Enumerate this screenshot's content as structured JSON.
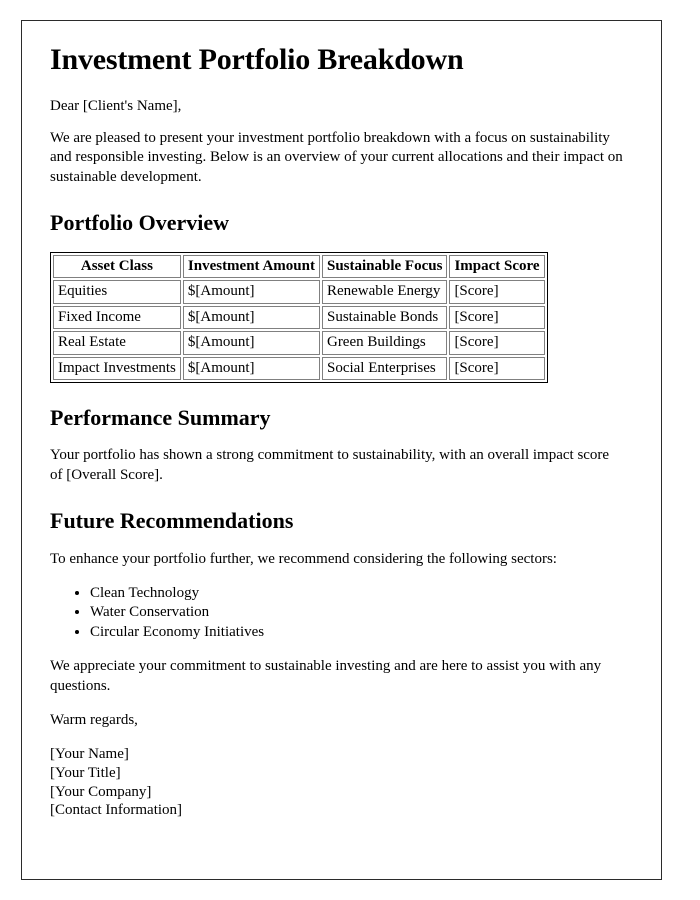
{
  "document": {
    "title": "Investment Portfolio Breakdown",
    "salutation": "Dear [Client's Name],",
    "intro_paragraph": "We are pleased to present your investment portfolio breakdown with a focus on sustainability and responsible investing. Below is an overview of your current allocations and their impact on sustainable development.",
    "sections": {
      "portfolio_overview": {
        "heading": "Portfolio Overview",
        "table": {
          "headers": [
            "Asset Class",
            "Investment Amount",
            "Sustainable Focus",
            "Impact Score"
          ],
          "rows": [
            [
              "Equities",
              "$[Amount]",
              "Renewable Energy",
              "[Score]"
            ],
            [
              "Fixed Income",
              "$[Amount]",
              "Sustainable Bonds",
              "[Score]"
            ],
            [
              "Real Estate",
              "$[Amount]",
              "Green Buildings",
              "[Score]"
            ],
            [
              "Impact Investments",
              "$[Amount]",
              "Social Enterprises",
              "[Score]"
            ]
          ]
        }
      },
      "performance_summary": {
        "heading": "Performance Summary",
        "paragraph": "Your portfolio has shown a strong commitment to sustainability, with an overall impact score of [Overall Score]."
      },
      "future_recommendations": {
        "heading": "Future Recommendations",
        "lead_in": "To enhance your portfolio further, we recommend considering the following sectors:",
        "items": [
          "Clean Technology",
          "Water Conservation",
          "Circular Economy Initiatives"
        ]
      }
    },
    "closing_paragraph": "We appreciate your commitment to sustainable investing and are here to assist you with any questions.",
    "valediction": "Warm regards,",
    "signature": {
      "name": "[Your Name]",
      "title": "[Your Title]",
      "company": "[Your Company]",
      "contact": "[Contact Information]"
    }
  },
  "colors": {
    "page_border": "#2b2b2b",
    "text": "#000000",
    "table_border": "#808080",
    "table_outer_border": "#000000",
    "background": "#ffffff"
  }
}
